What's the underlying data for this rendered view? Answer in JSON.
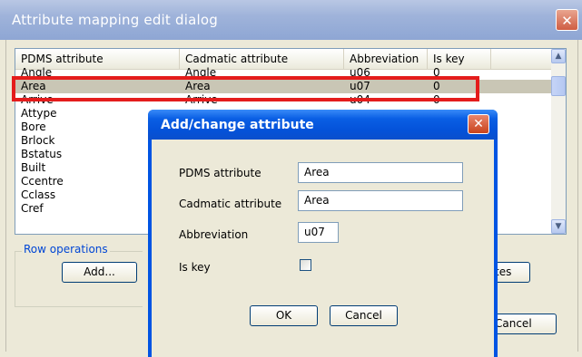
{
  "main_dialog": {
    "title": "Attribute mapping edit dialog",
    "close_glyph": "✕",
    "list": {
      "columns": [
        "PDMS attribute",
        "Cadmatic attribute",
        "Abbreviation",
        "Is key"
      ],
      "rows": [
        {
          "pdms": "Angle",
          "cadmatic": "Angle",
          "abbr": "u06",
          "key": "0"
        },
        {
          "pdms": "Area",
          "cadmatic": "Area",
          "abbr": "u07",
          "key": "0"
        },
        {
          "pdms": "Arrive",
          "cadmatic": "Arrive",
          "abbr": "u04",
          "key": "0"
        },
        {
          "pdms": "Attype",
          "cadmatic": "",
          "abbr": "",
          "key": ""
        },
        {
          "pdms": "Bore",
          "cadmatic": "",
          "abbr": "",
          "key": ""
        },
        {
          "pdms": "Brlock",
          "cadmatic": "",
          "abbr": "",
          "key": ""
        },
        {
          "pdms": "Bstatus",
          "cadmatic": "",
          "abbr": "",
          "key": ""
        },
        {
          "pdms": "Built",
          "cadmatic": "",
          "abbr": "",
          "key": ""
        },
        {
          "pdms": "Ccentre",
          "cadmatic": "",
          "abbr": "",
          "key": ""
        },
        {
          "pdms": "Cclass",
          "cadmatic": "",
          "abbr": "",
          "key": ""
        },
        {
          "pdms": "Cref",
          "cadmatic": "",
          "abbr": "",
          "key": ""
        }
      ]
    },
    "row_operations_label": "Row operations",
    "add_button": "Add...",
    "partial_button_text": "tes",
    "cancel_button": "Cancel"
  },
  "sub_dialog": {
    "title": "Add/change attribute",
    "close_glyph": "✕",
    "fields": {
      "pdms_label": "PDMS attribute",
      "pdms_value": "Area",
      "cadmatic_label": "Cadmatic attribute",
      "cadmatic_value": "Area",
      "abbr_label": "Abbreviation",
      "abbr_value": "u07",
      "iskey_label": "Is key",
      "iskey_checked": false
    },
    "ok_button": "OK",
    "cancel_button": "Cancel"
  },
  "colors": {
    "highlight": "#e41c1c",
    "sub_title_bar": "#0a5fe4",
    "main_title_bar": "#9fb3da"
  }
}
